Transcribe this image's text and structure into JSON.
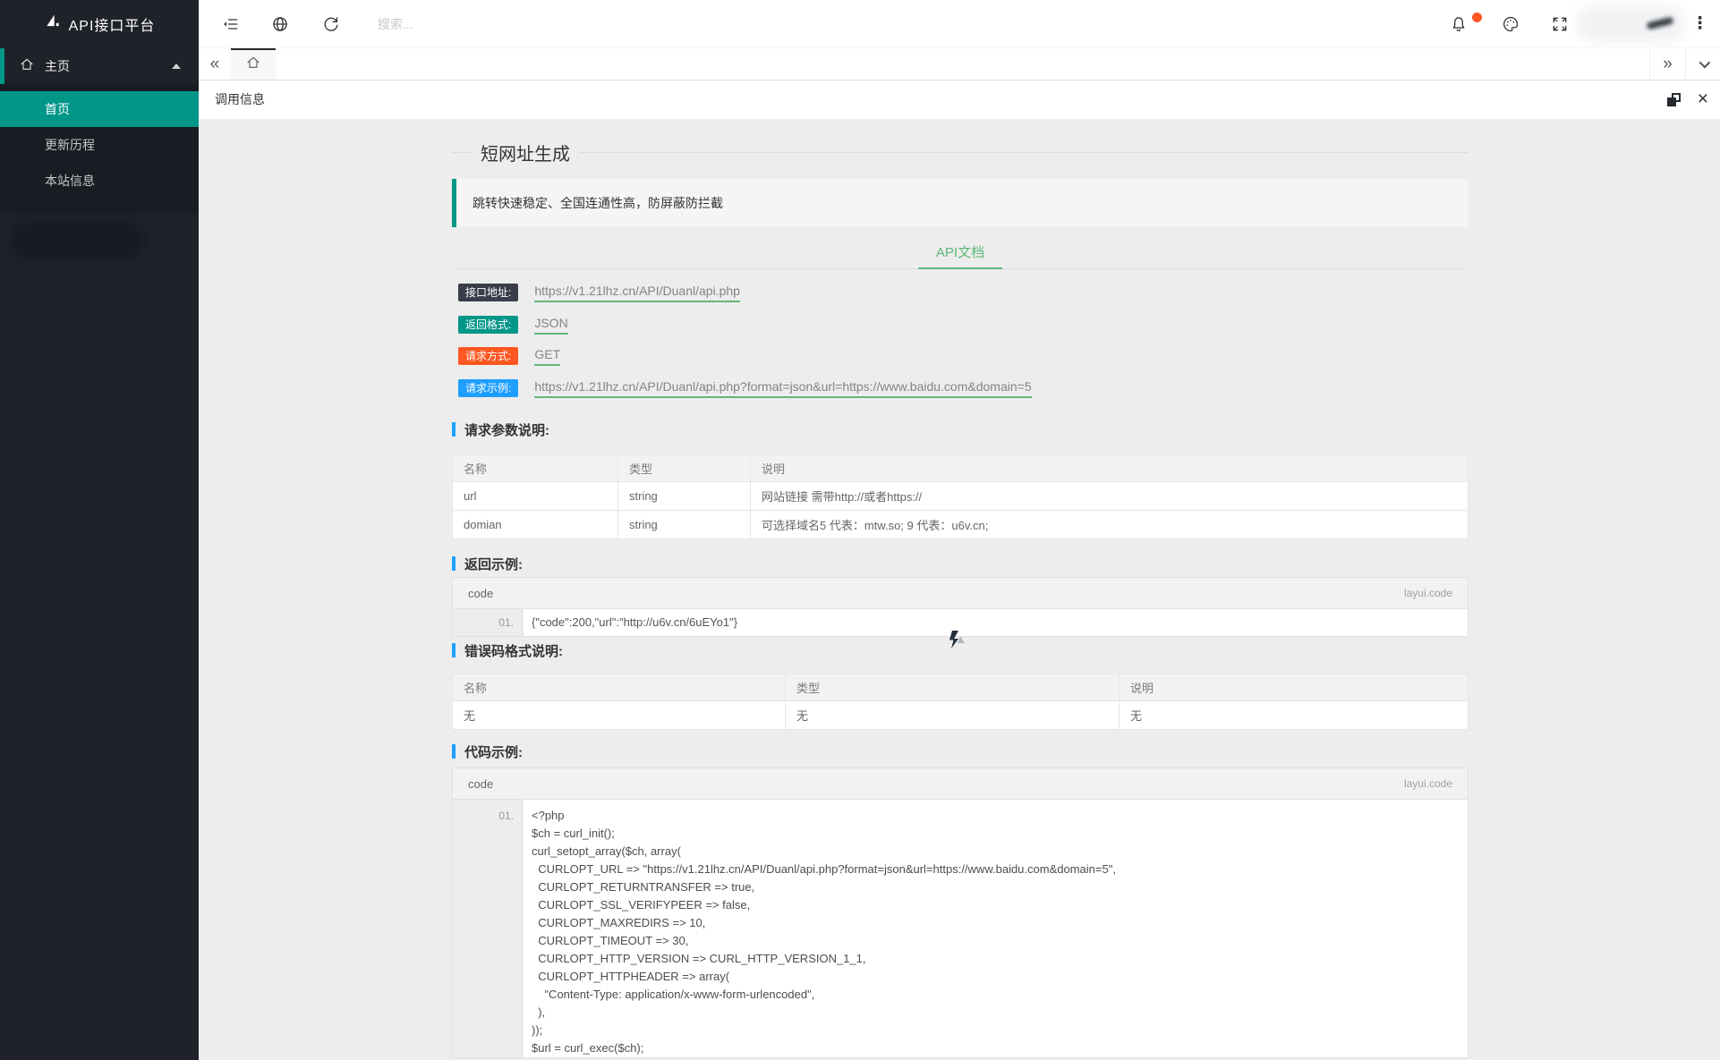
{
  "app": {
    "logo_title": "API接口平台"
  },
  "colors": {
    "accent_teal": "#009688",
    "green": "#5FB878",
    "blue": "#1E9FFF",
    "orange": "#FF5722",
    "dark_badge": "#393D49",
    "sidebar_bg": "#20222A"
  },
  "icons": [
    "logo-sail-icon",
    "home-icon",
    "collapse-sidebar-icon",
    "globe-icon",
    "refresh-icon",
    "bell-icon",
    "palette-icon",
    "fullscreen-icon",
    "more-menu-icon",
    "tabs-scroll-left-icon",
    "tab-home-icon",
    "tabs-scroll-right-icon",
    "tabs-dropdown-icon",
    "maximize-icon",
    "close-icon",
    "broken-image-icon"
  ],
  "sidebar": {
    "parent": {
      "label": "主页"
    },
    "items": [
      {
        "label": "首页",
        "active": true
      },
      {
        "label": "更新历程",
        "active": false
      },
      {
        "label": "本站信息",
        "active": false
      }
    ]
  },
  "topbar": {
    "search_placeholder": "搜索...",
    "more_glyph": "⋮"
  },
  "tabbar": {
    "scroll_left": "«",
    "scroll_right": "»"
  },
  "content_header": {
    "title": "调用信息",
    "close_glyph": "×"
  },
  "doc": {
    "title": "短网址生成",
    "quote": "跳转快速稳定、全国连通性高，防屏蔽防拦截",
    "tab": "API文档",
    "fields": [
      {
        "label": "接口地址:",
        "value": "https://v1.21lhz.cn/API/Duanl/api.php"
      },
      {
        "label": "返回格式:",
        "value": "JSON"
      },
      {
        "label": "请求方式:",
        "value": "GET"
      },
      {
        "label": "请求示例:",
        "value": "https://v1.21lhz.cn/API/Duanl/api.php?format=json&url=https://www.baidu.com&domain=5"
      }
    ],
    "params": {
      "heading": "请求参数说明:",
      "columns": [
        "名称",
        "类型",
        "说明"
      ],
      "rows": [
        [
          "url",
          "string",
          "网站链接 需带http://或者https://"
        ],
        [
          "domian",
          "string",
          "可选择域名5 代表：mtw.so; 9 代表：u6v.cn;"
        ]
      ]
    },
    "response": {
      "heading": "返回示例:",
      "code_title": "code",
      "code_brand": "layui.code",
      "line_no": "01.",
      "code": "{\"code\":200,\"url\":\"http://u6v.cn/6uEYo1\"}"
    },
    "errors": {
      "heading": "错误码格式说明:",
      "columns": [
        "名称",
        "类型",
        "说明"
      ],
      "rows": [
        [
          "无",
          "无",
          "无"
        ]
      ]
    },
    "example": {
      "heading": "代码示例:",
      "code_title": "code",
      "code_brand": "layui.code",
      "line_no": "01.",
      "lines": [
        "<?php",
        "$ch = curl_init();",
        "curl_setopt_array($ch, array(",
        "  CURLOPT_URL => \"https://v1.21lhz.cn/API/Duanl/api.php?format=json&url=https://www.baidu.com&domain=5\",",
        "  CURLOPT_RETURNTRANSFER => true,",
        "  CURLOPT_SSL_VERIFYPEER => false,",
        "  CURLOPT_MAXREDIRS => 10,",
        "  CURLOPT_TIMEOUT => 30,",
        "  CURLOPT_HTTP_VERSION => CURL_HTTP_VERSION_1_1,",
        "  CURLOPT_HTTPHEADER => array(",
        "    \"Content-Type: application/x-www-form-urlencoded\",",
        "  ),",
        "));",
        "$url = curl_exec($ch);"
      ]
    }
  }
}
